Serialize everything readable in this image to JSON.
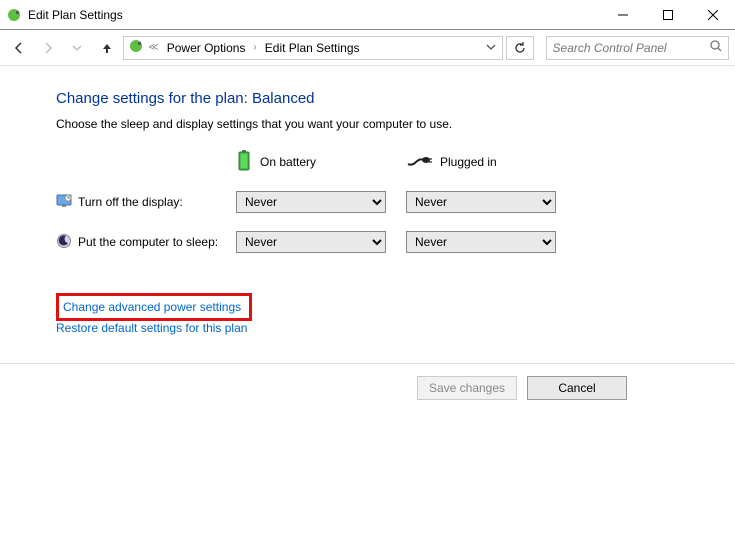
{
  "titlebar": {
    "title": "Edit Plan Settings"
  },
  "breadcrumb": {
    "item1": "Power Options",
    "item2": "Edit Plan Settings"
  },
  "search": {
    "placeholder": "Search Control Panel"
  },
  "page": {
    "heading": "Change settings for the plan: Balanced",
    "subtext": "Choose the sleep and display settings that you want your computer to use."
  },
  "columns": {
    "battery": "On battery",
    "plugged": "Plugged in"
  },
  "rows": {
    "display": {
      "label": "Turn off the display:",
      "battery": "Never",
      "plugged": "Never"
    },
    "sleep": {
      "label": "Put the computer to sleep:",
      "battery": "Never",
      "plugged": "Never"
    }
  },
  "links": {
    "advanced": "Change advanced power settings",
    "restore": "Restore default settings for this plan"
  },
  "buttons": {
    "save": "Save changes",
    "cancel": "Cancel"
  }
}
